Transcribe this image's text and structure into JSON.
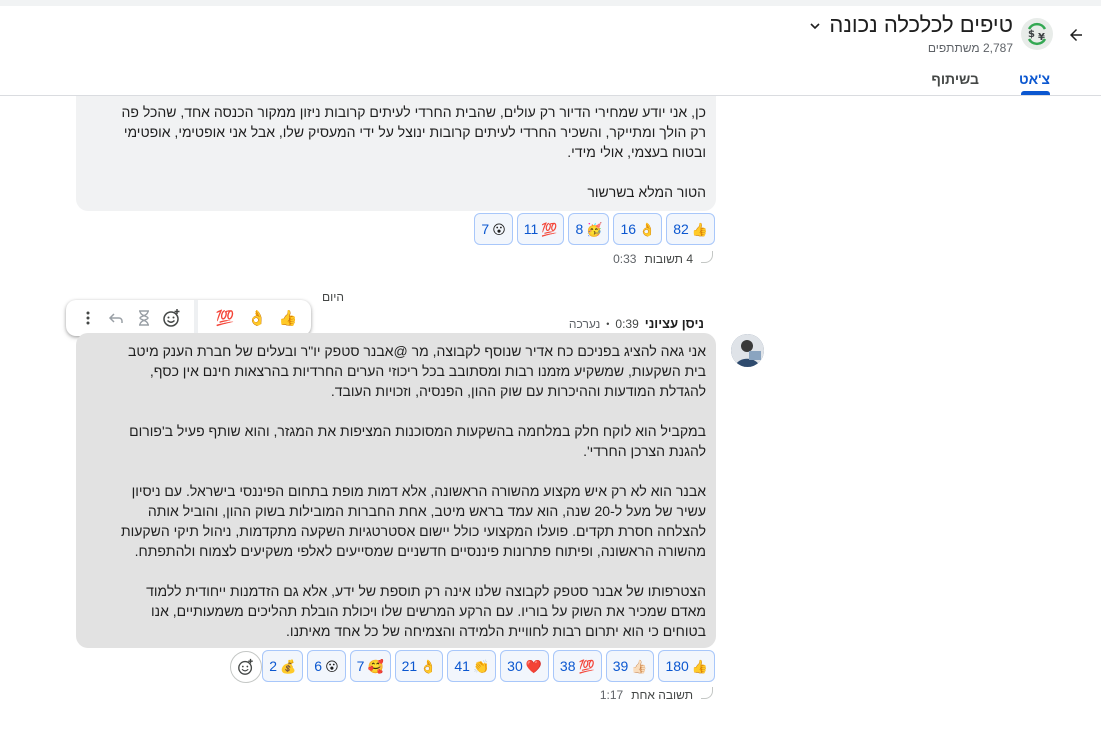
{
  "header": {
    "group_title": "טיפים לכלכלה נכונה",
    "member_count": "2,787 משתתפים",
    "tabs": [
      {
        "label": "צ'אט",
        "active": true
      },
      {
        "label": "בשיתוף",
        "active": false
      }
    ]
  },
  "message1": {
    "lines": [
      "כן, אני יודע שמחירי הדיור רק עולים, שהבית החרדי לעיתים קרובות ניזון ממקור הכנסה אחד, שהכל פה",
      "רק הולך ומתייקר, והשכיר החרדי לעיתים קרובות ינוצל על ידי המעסיק שלו, אבל אני אופטימי, אופטימי",
      "ובטוח בעצמי, אולי מידי."
    ],
    "footer_line": "הטור המלא בשרשור",
    "reactions": [
      {
        "emoji": "👍",
        "count": "82"
      },
      {
        "emoji": "👌",
        "count": "16"
      },
      {
        "emoji": "🥳",
        "count": "8"
      },
      {
        "emoji": "💯",
        "count": "11"
      },
      {
        "emoji": "😮",
        "count": "7"
      }
    ],
    "thread_label": "4 תשובות",
    "thread_time": "0:33"
  },
  "day_divider": "היום",
  "message2": {
    "sender_name": "ניסן עציוני",
    "time": "0:39",
    "edited_label": "נערכה",
    "paragraphs": [
      [
        "אני גאה להציג בפניכם כח אדיר שנוסף לקבוצה, מר  @אבנר סטפק  יו\"ר ובעלים של חברת הענק מיטב",
        "בית השקעות, שמשקיע מזמנו רבות ומסתובב בכל ריכוזי הערים החרדיות בהרצאות חינם אין כסף,",
        "להגדלת המודעות וההיכרות עם שוק ההון, הפנסיה, וזכויות העובד."
      ],
      [
        "במקביל הוא לוקח חלק במלחמה בהשקעות המסוכנות המציפות את המגזר, והוא שותף פעיל ב'פורום",
        "להגנת הצרכן החרדי'."
      ],
      [
        "אבנר הוא לא רק איש מקצוע מהשורה הראשונה, אלא דמות מופת בתחום הפיננסי בישראל. עם ניסיון",
        "עשיר של מעל ל-20 שנה, הוא עמד בראש מיטב, אחת החברות המובילות בשוק ההון, והוביל אותה",
        "להצלחה חסרת תקדים. פועלו המקצועי כולל יישום אסטרטגיות השקעה מתקדמות, ניהול תיקי השקעות",
        "מהשורה הראשונה, ופיתוח פתרונות פיננסיים חדשניים שמסייעים לאלפי משקיעים לצמוח ולהתפתח."
      ],
      [
        "הצטרפותו של אבנר סטפק לקבוצה שלנו אינה רק תוספת של ידע, אלא גם הזדמנות ייחודית ללמוד",
        "מאדם שמכיר את השוק על בוריו. עם הרקע המרשים שלו ויכולת הובלת תהליכים משמעותיים, אנו",
        "בטוחים כי הוא יתרום רבות לחוויית הלמידה והצמיחה של כל אחד מאיתנו."
      ]
    ],
    "reactions": [
      {
        "emoji": "👍",
        "count": "180"
      },
      {
        "emoji": "👍🏻",
        "count": "39"
      },
      {
        "emoji": "💯",
        "count": "38"
      },
      {
        "emoji": "❤️",
        "count": "30"
      },
      {
        "emoji": "👏",
        "count": "41"
      },
      {
        "emoji": "👌",
        "count": "21"
      },
      {
        "emoji": "🥰",
        "count": "7"
      },
      {
        "emoji": "😮",
        "count": "6"
      },
      {
        "emoji": "💰",
        "count": "2"
      }
    ],
    "thread_label": "תשובה אחת",
    "thread_time": "1:17"
  },
  "hover_toolbar": {
    "quick_reactions": [
      "👍",
      "👌",
      "💯"
    ],
    "icons": [
      "add-reaction-icon",
      "hourglass-icon",
      "reply-icon",
      "more-vert-icon"
    ]
  },
  "colors": {
    "accent": "#0b57d0",
    "bubble_own": "#f1f2f3",
    "bubble_selected": "#e2e2e2",
    "chip_border": "#a8c7fa"
  }
}
